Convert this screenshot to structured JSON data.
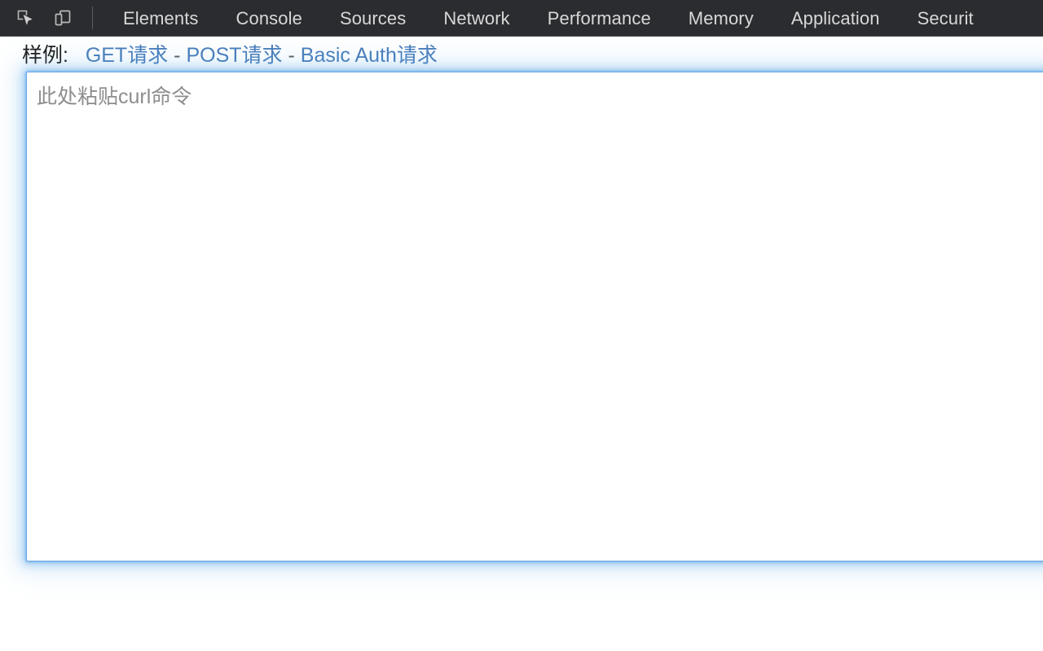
{
  "devtools": {
    "icons": [
      {
        "name": "inspect-element-icon",
        "title": "Inspect element"
      },
      {
        "name": "device-toolbar-icon",
        "title": "Toggle device toolbar"
      }
    ],
    "tabs": [
      {
        "label": "Elements",
        "selected": false
      },
      {
        "label": "Console",
        "selected": false
      },
      {
        "label": "Sources",
        "selected": false
      },
      {
        "label": "Network",
        "selected": false
      },
      {
        "label": "Performance",
        "selected": false
      },
      {
        "label": "Memory",
        "selected": false
      },
      {
        "label": "Application",
        "selected": false
      },
      {
        "label": "Securit",
        "selected": false
      }
    ],
    "colors": {
      "toolbar_background": "#2b2c2f",
      "tab_text": "#d8d8d8",
      "separator": "#5a5b5e"
    }
  },
  "page": {
    "examples": {
      "label": "样例:",
      "separator": "-",
      "links": [
        {
          "label": "GET请求"
        },
        {
          "label": "POST请求"
        },
        {
          "label": "Basic Auth请求"
        }
      ]
    },
    "curl_input": {
      "placeholder": "此处粘贴curl命令",
      "value": ""
    },
    "colors": {
      "link": "#4a7ebb",
      "focus_glow": "#66afe9",
      "input_border": "#6aa5e8",
      "placeholder_text": "#8d8d8d"
    }
  }
}
